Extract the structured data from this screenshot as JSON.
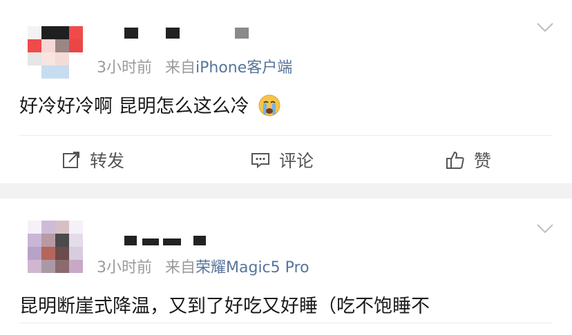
{
  "feed": {
    "posts": [
      {
        "time": "3小时前",
        "source_prefix": "来自",
        "source": "iPhone客户端",
        "text": "好冷好冷啊 昆明怎么这么冷",
        "emoji": "crying-face-icon"
      },
      {
        "time": "3小时前",
        "source_prefix": "来自",
        "source": "荣耀Magic5 Pro",
        "text": "昆明断崖式降温，又到了好吃又好睡（吃不饱睡不"
      }
    ],
    "actions": {
      "repost": "转发",
      "comment": "评论",
      "like": "赞"
    }
  },
  "colors": {
    "link": "#56759b",
    "meta": "#9a9a9a",
    "text": "#1a1a1a",
    "separator": "#f2f2f2"
  }
}
